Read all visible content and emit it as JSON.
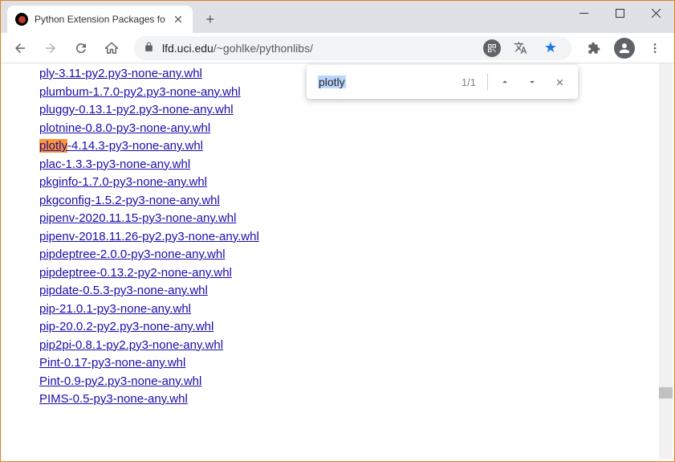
{
  "window": {
    "tab_title": "Python Extension Packages fo"
  },
  "url": {
    "domain": "lfd.uci.edu",
    "path": "/~gohlke/pythonlibs/"
  },
  "find": {
    "query": "plotly",
    "count": "1/1"
  },
  "links": [
    {
      "text": "ply-3.11-py2.py3-none-any.whl",
      "highlight_prefix": ""
    },
    {
      "text": "plumbum-1.7.0-py2.py3-none-any.whl",
      "highlight_prefix": ""
    },
    {
      "text": "pluggy-0.13.1-py2.py3-none-any.whl",
      "highlight_prefix": ""
    },
    {
      "text": "plotnine-0.8.0-py3-none-any.whl",
      "highlight_prefix": ""
    },
    {
      "text": "-4.14.3-py3-none-any.whl",
      "highlight_prefix": "plotly"
    },
    {
      "text": "plac-1.3.3-py3-none-any.whl",
      "highlight_prefix": ""
    },
    {
      "text": "pkginfo-1.7.0-py3-none-any.whl",
      "highlight_prefix": ""
    },
    {
      "text": "pkgconfig-1.5.2-py3-none-any.whl",
      "highlight_prefix": ""
    },
    {
      "text": "pipenv-2020.11.15-py3-none-any.whl",
      "highlight_prefix": ""
    },
    {
      "text": "pipenv-2018.11.26-py2.py3-none-any.whl",
      "highlight_prefix": ""
    },
    {
      "text": "pipdeptree-2.0.0-py3-none-any.whl",
      "highlight_prefix": ""
    },
    {
      "text": "pipdeptree-0.13.2-py2-none-any.whl",
      "highlight_prefix": ""
    },
    {
      "text": "pipdate-0.5.3-py3-none-any.whl",
      "highlight_prefix": ""
    },
    {
      "text": "pip-21.0.1-py3-none-any.whl",
      "highlight_prefix": ""
    },
    {
      "text": "pip-20.0.2-py2.py3-none-any.whl",
      "highlight_prefix": ""
    },
    {
      "text": "pip2pi-0.8.1-py2.py3-none-any.whl",
      "highlight_prefix": ""
    },
    {
      "text": "Pint-0.17-py3-none-any.whl",
      "highlight_prefix": ""
    },
    {
      "text": "Pint-0.9-py2.py3-none-any.whl",
      "highlight_prefix": ""
    },
    {
      "text": "PIMS-0.5-py3-none-any.whl",
      "highlight_prefix": ""
    }
  ]
}
